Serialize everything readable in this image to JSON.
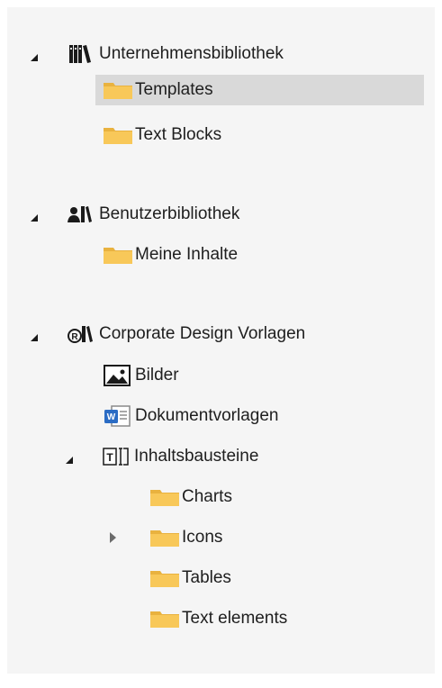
{
  "colors": {
    "panel_bg": "#f5f5f5",
    "selection_bg": "#d9d9d9",
    "folder": "#f8c859",
    "word_blue": "#2b6cc4"
  },
  "tree": {
    "groups": [
      {
        "label": "Unternehmensbibliothek",
        "icon": "library-books-icon",
        "expanded": true,
        "children": [
          {
            "label": "Templates",
            "icon": "folder-icon",
            "selected": true
          },
          {
            "label": "Text Blocks",
            "icon": "folder-icon"
          }
        ]
      },
      {
        "label": "Benutzerbibliothek",
        "icon": "user-library-icon",
        "expanded": true,
        "children": [
          {
            "label": "Meine Inhalte",
            "icon": "folder-icon"
          }
        ]
      },
      {
        "label": "Corporate Design Vorlagen",
        "icon": "registered-library-icon",
        "expanded": true,
        "children": [
          {
            "label": "Bilder",
            "icon": "image-icon"
          },
          {
            "label": "Dokumentvorlagen",
            "icon": "word-document-icon"
          },
          {
            "label": "Inhaltsbausteine",
            "icon": "text-block-icon",
            "expanded": true,
            "children": [
              {
                "label": "Charts",
                "icon": "folder-icon"
              },
              {
                "label": "Icons",
                "icon": "folder-icon",
                "collapsed": true
              },
              {
                "label": "Tables",
                "icon": "folder-icon"
              },
              {
                "label": "Text elements",
                "icon": "folder-icon"
              }
            ]
          }
        ]
      }
    ]
  }
}
